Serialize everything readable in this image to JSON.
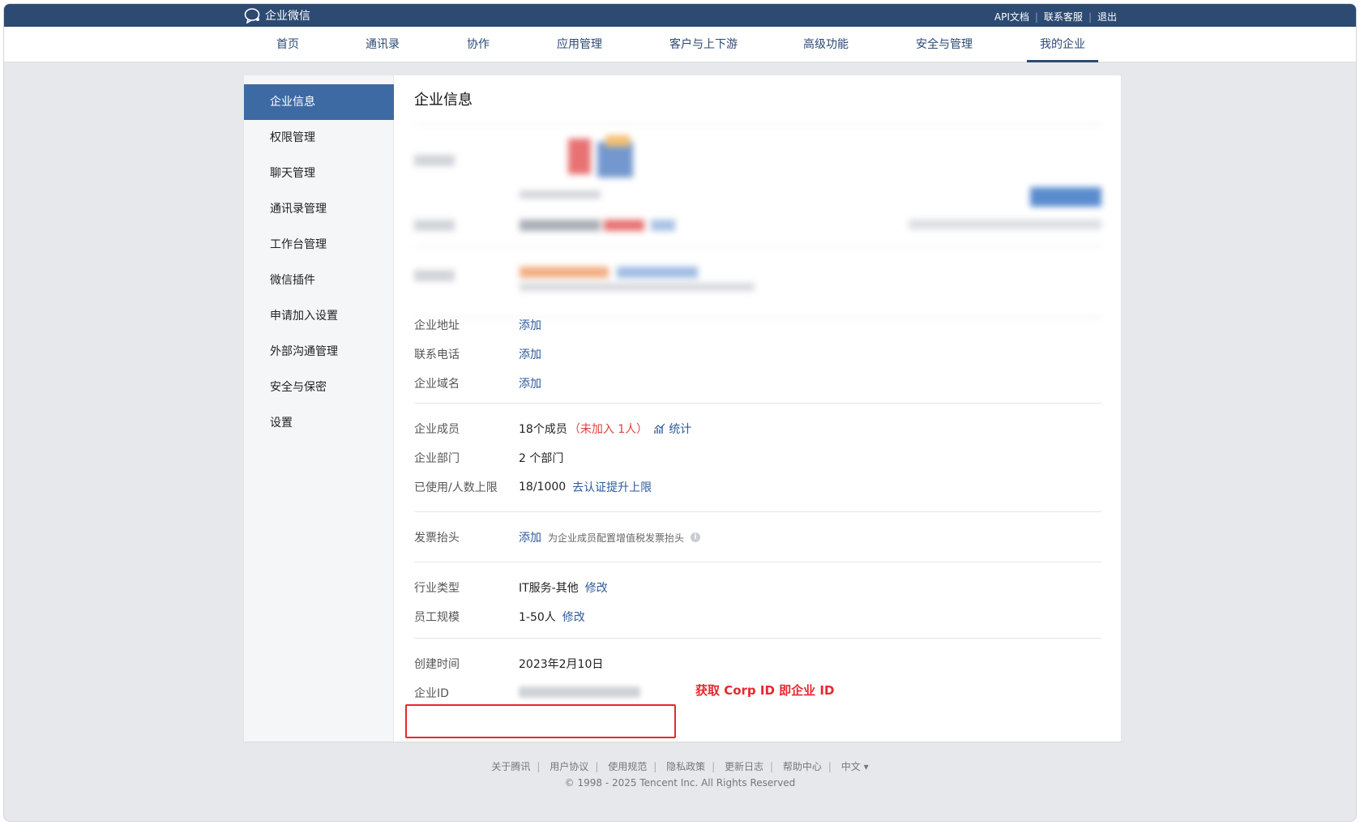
{
  "header": {
    "brand": "企业微信",
    "links": [
      "API文档",
      "联系客服",
      "退出"
    ]
  },
  "nav": {
    "items": [
      "首页",
      "通讯录",
      "协作",
      "应用管理",
      "客户与上下游",
      "高级功能",
      "安全与管理",
      "我的企业"
    ],
    "active": "我的企业"
  },
  "sidebar": {
    "items": [
      "企业信息",
      "权限管理",
      "聊天管理",
      "通讯录管理",
      "工作台管理",
      "微信插件",
      "申请加入设置",
      "外部沟通管理",
      "安全与保密",
      "设置"
    ],
    "active": "企业信息"
  },
  "content": {
    "title": "企业信息",
    "address": {
      "label": "企业地址",
      "action": "添加"
    },
    "phone": {
      "label": "联系电话",
      "action": "添加"
    },
    "domain": {
      "label": "企业域名",
      "action": "添加"
    },
    "members": {
      "label": "企业成员",
      "count": "18个成员",
      "not_joined": "（未加入 1人）",
      "stats": "统计"
    },
    "departments": {
      "label": "企业部门",
      "value": "2 个部门"
    },
    "limit": {
      "label": "已使用/人数上限",
      "value": "18/1000",
      "action": "去认证提升上限"
    },
    "invoice": {
      "label": "发票抬头",
      "action": "添加",
      "hint": "为企业成员配置增值税发票抬头"
    },
    "industry": {
      "label": "行业类型",
      "value": "IT服务-其他",
      "action": "修改"
    },
    "scale": {
      "label": "员工规模",
      "value": "1-50人",
      "action": "修改"
    },
    "created": {
      "label": "创建时间",
      "value": "2023年2月10日"
    },
    "corp_id": {
      "label": "企业ID"
    }
  },
  "annotation": {
    "text": "获取 Corp ID 即企业 ID",
    "color": "#e8272e"
  },
  "footer": {
    "links": [
      "关于腾讯",
      "用户协议",
      "使用规范",
      "隐私政策",
      "更新日志",
      "帮助中心",
      "中文 ▾"
    ],
    "copyright": "© 1998 - 2025 Tencent Inc. All Rights Reserved"
  },
  "colors": {
    "topbar": "#2c4a72",
    "sidebar_active": "#3e6aa4",
    "link": "#2c5a9a",
    "warn": "#e0403b"
  }
}
